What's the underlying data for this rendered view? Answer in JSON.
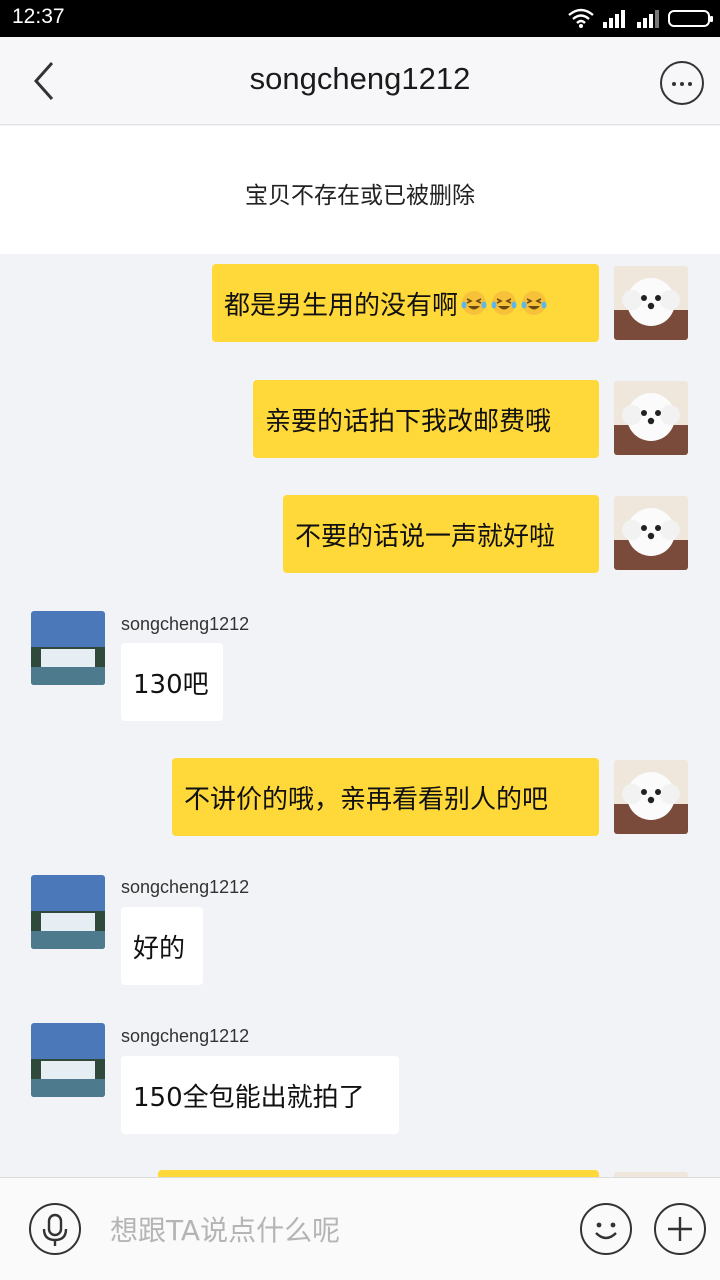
{
  "status_bar": {
    "time": "12:37"
  },
  "header": {
    "title": "songcheng1212"
  },
  "notice": {
    "text": "宝贝不存在或已被删除"
  },
  "messages": [
    {
      "from": "me",
      "text": "都是男生用的没有啊",
      "emoji": [
        "crying-laughing-emoji",
        "crying-laughing-emoji",
        "crying-laughing-emoji"
      ]
    },
    {
      "from": "me",
      "text": "亲要的话拍下我改邮费哦"
    },
    {
      "from": "me",
      "text": "不要的话说一声就好啦"
    },
    {
      "from": "other",
      "sender": "songcheng1212",
      "text": "130吧"
    },
    {
      "from": "me",
      "text": "不讲价的哦，亲再看看别人的吧"
    },
    {
      "from": "other",
      "sender": "songcheng1212",
      "text": "好的"
    },
    {
      "from": "other",
      "sender": "songcheng1212",
      "text": "150全包能出就拍了"
    }
  ],
  "input": {
    "placeholder": "想跟TA说点什么呢"
  },
  "colors": {
    "my_bubble": "#ffd83a",
    "chat_background": "#f2f3f7",
    "status_bar": "#000000"
  }
}
